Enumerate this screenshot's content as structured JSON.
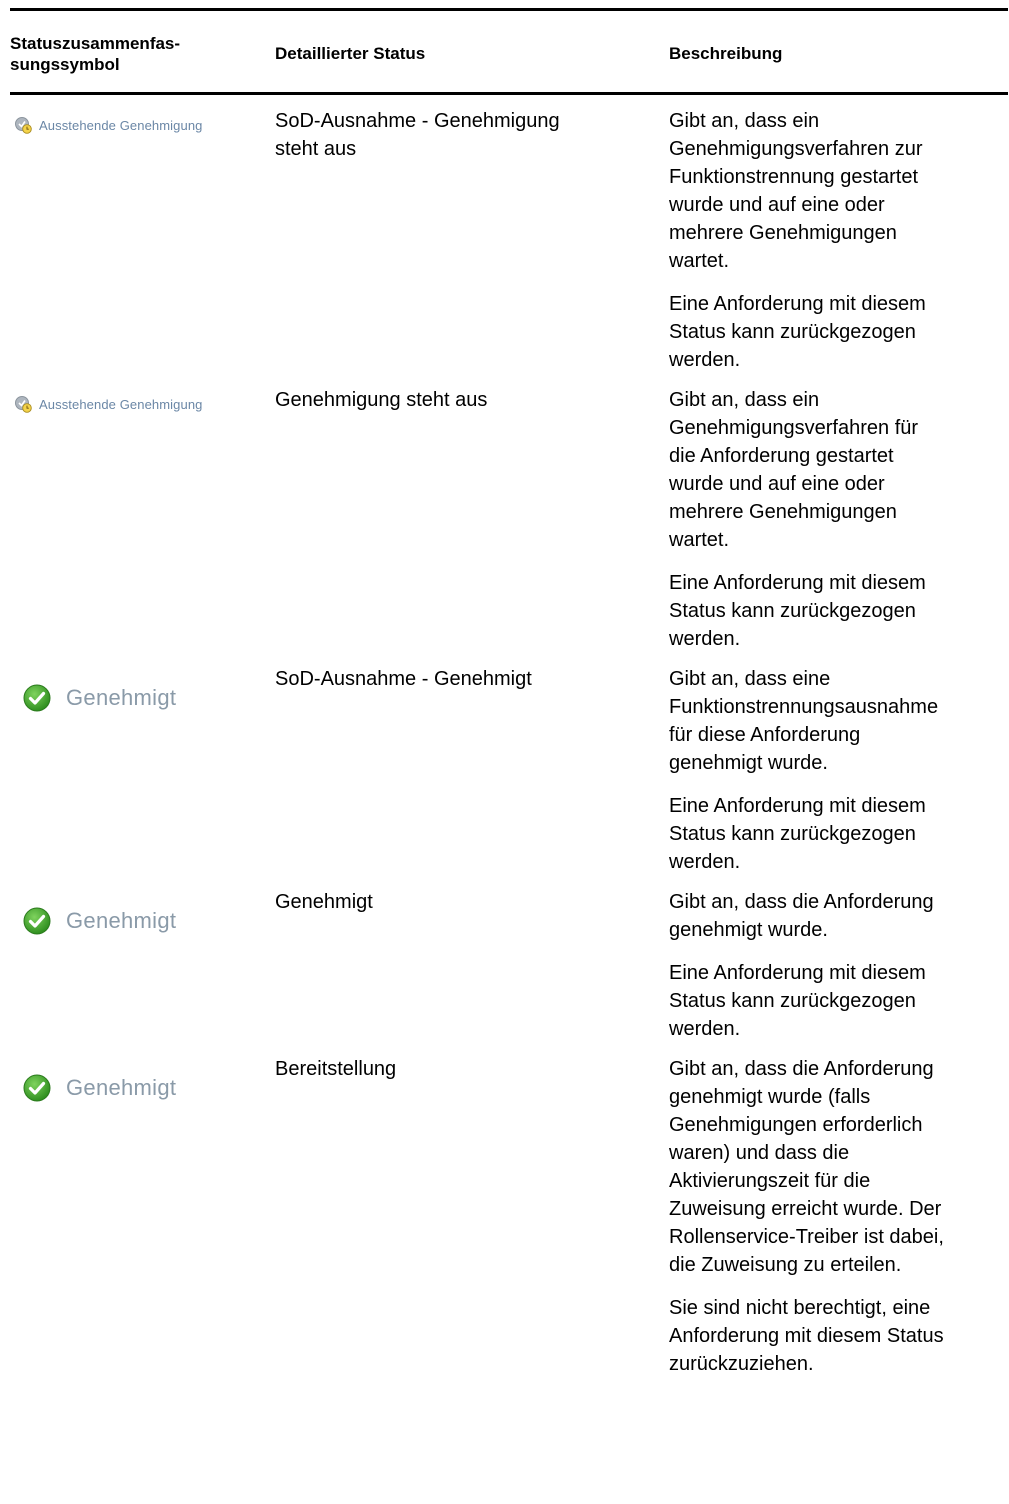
{
  "table": {
    "headers": {
      "summary": "Statuszusammenfas-\nsungssymbol",
      "summary_line1": "Statuszusammenfas-",
      "summary_line2": "sungssymbol",
      "detail": "Detaillierter Status",
      "description": "Beschreibung"
    },
    "rows": [
      {
        "symbol_label": "Ausstehende Genehmigung",
        "symbol_icon": "pending-clock-icon",
        "detail_line1": "SoD-Ausnahme - Genehmigung",
        "detail_line2": "steht aus",
        "desc1": [
          "Gibt an, dass ein",
          "Genehmigungsverfahren zur",
          "Funktionstrennung gestartet",
          "wurde und auf eine oder",
          "mehrere Genehmigungen",
          "wartet."
        ],
        "desc2": [
          "Eine Anforderung mit diesem",
          "Status kann zurückgezogen",
          "werden."
        ]
      },
      {
        "symbol_label": "Ausstehende Genehmigung",
        "symbol_icon": "pending-clock-icon",
        "detail_line1": "Genehmigung steht aus",
        "desc1": [
          "Gibt an, dass ein",
          "Genehmigungsverfahren für",
          "die Anforderung gestartet",
          "wurde und auf eine oder",
          "mehrere Genehmigungen",
          "wartet."
        ],
        "desc2": [
          "Eine Anforderung mit diesem",
          "Status kann zurückgezogen",
          "werden."
        ]
      },
      {
        "symbol_label": "Genehmigt",
        "symbol_icon": "green-check-icon",
        "detail_line1": "SoD-Ausnahme - Genehmigt",
        "desc1": [
          "Gibt an, dass eine",
          "Funktionstrennungsausnahme",
          "für diese Anforderung",
          "genehmigt wurde."
        ],
        "desc2": [
          "Eine Anforderung mit diesem",
          "Status kann zurückgezogen",
          "werden."
        ]
      },
      {
        "symbol_label": "Genehmigt",
        "symbol_icon": "green-check-icon",
        "detail_line1": "Genehmigt",
        "desc1": [
          "Gibt an, dass die Anforderung",
          "genehmigt wurde."
        ],
        "desc2": [
          "Eine Anforderung mit diesem",
          "Status kann zurückgezogen",
          "werden."
        ]
      },
      {
        "symbol_label": "Genehmigt",
        "symbol_icon": "green-check-icon",
        "detail_line1": "Bereitstellung",
        "desc1": [
          "Gibt an, dass die Anforderung",
          "genehmigt wurde (falls",
          "Genehmigungen erforderlich",
          "waren) und dass die",
          "Aktivierungszeit für die",
          "Zuweisung erreicht wurde. Der",
          "Rollenservice-Treiber ist dabei,",
          "die Zuweisung zu erteilen."
        ],
        "desc2": [
          "Sie sind nicht berechtigt, eine",
          "Anforderung mit diesem Status",
          "zurückzuziehen."
        ]
      }
    ]
  },
  "colors": {
    "check_green": "#3aa62a",
    "pending_text": "#6b87a6",
    "approved_text": "#8a9aa8"
  }
}
